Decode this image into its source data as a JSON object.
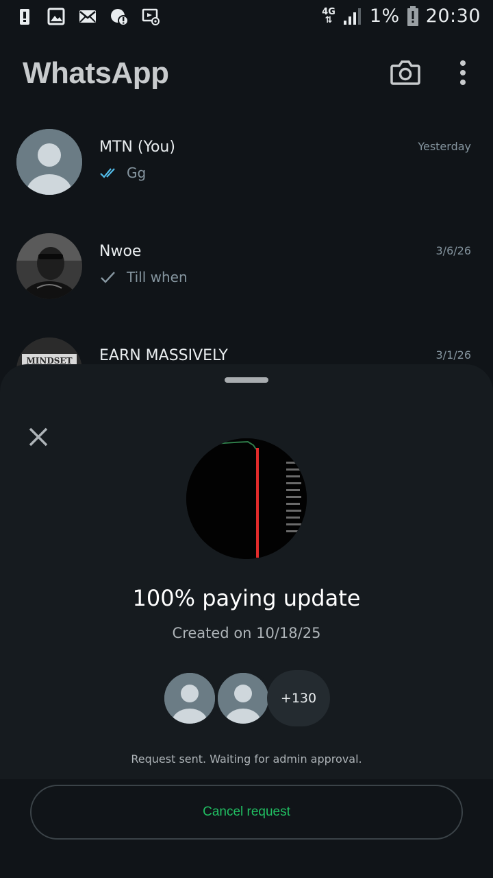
{
  "status_bar": {
    "network": "4G",
    "battery": "1%",
    "time": "20:30",
    "left_icons": [
      "battery-alert-icon",
      "gallery-icon",
      "mail-icon",
      "whatsapp-notification-icon",
      "screencast-icon"
    ]
  },
  "app": {
    "title": "WhatsApp"
  },
  "chats": [
    {
      "name": "MTN (You)",
      "time": "Yesterday",
      "preview": "Gg",
      "status": "read"
    },
    {
      "name": "Nwoe",
      "time": "3/6/26",
      "preview": "Till when",
      "status": "sent"
    },
    {
      "name": "EARN MASSIVELY",
      "time": "3/1/26",
      "preview": "",
      "status": "",
      "avatar_text": "MINDSET"
    }
  ],
  "sheet": {
    "group_name": "100% paying update",
    "created": "Created on 10/18/25",
    "members_more": "+130",
    "request_status": "Request sent. Waiting for admin approval.",
    "cancel_label": "Cancel request"
  },
  "colors": {
    "background": "#101418",
    "sheet": "#161b1f",
    "accent_green": "#21c063",
    "read_tick": "#53bdeb",
    "muted_text": "#8696a0"
  }
}
